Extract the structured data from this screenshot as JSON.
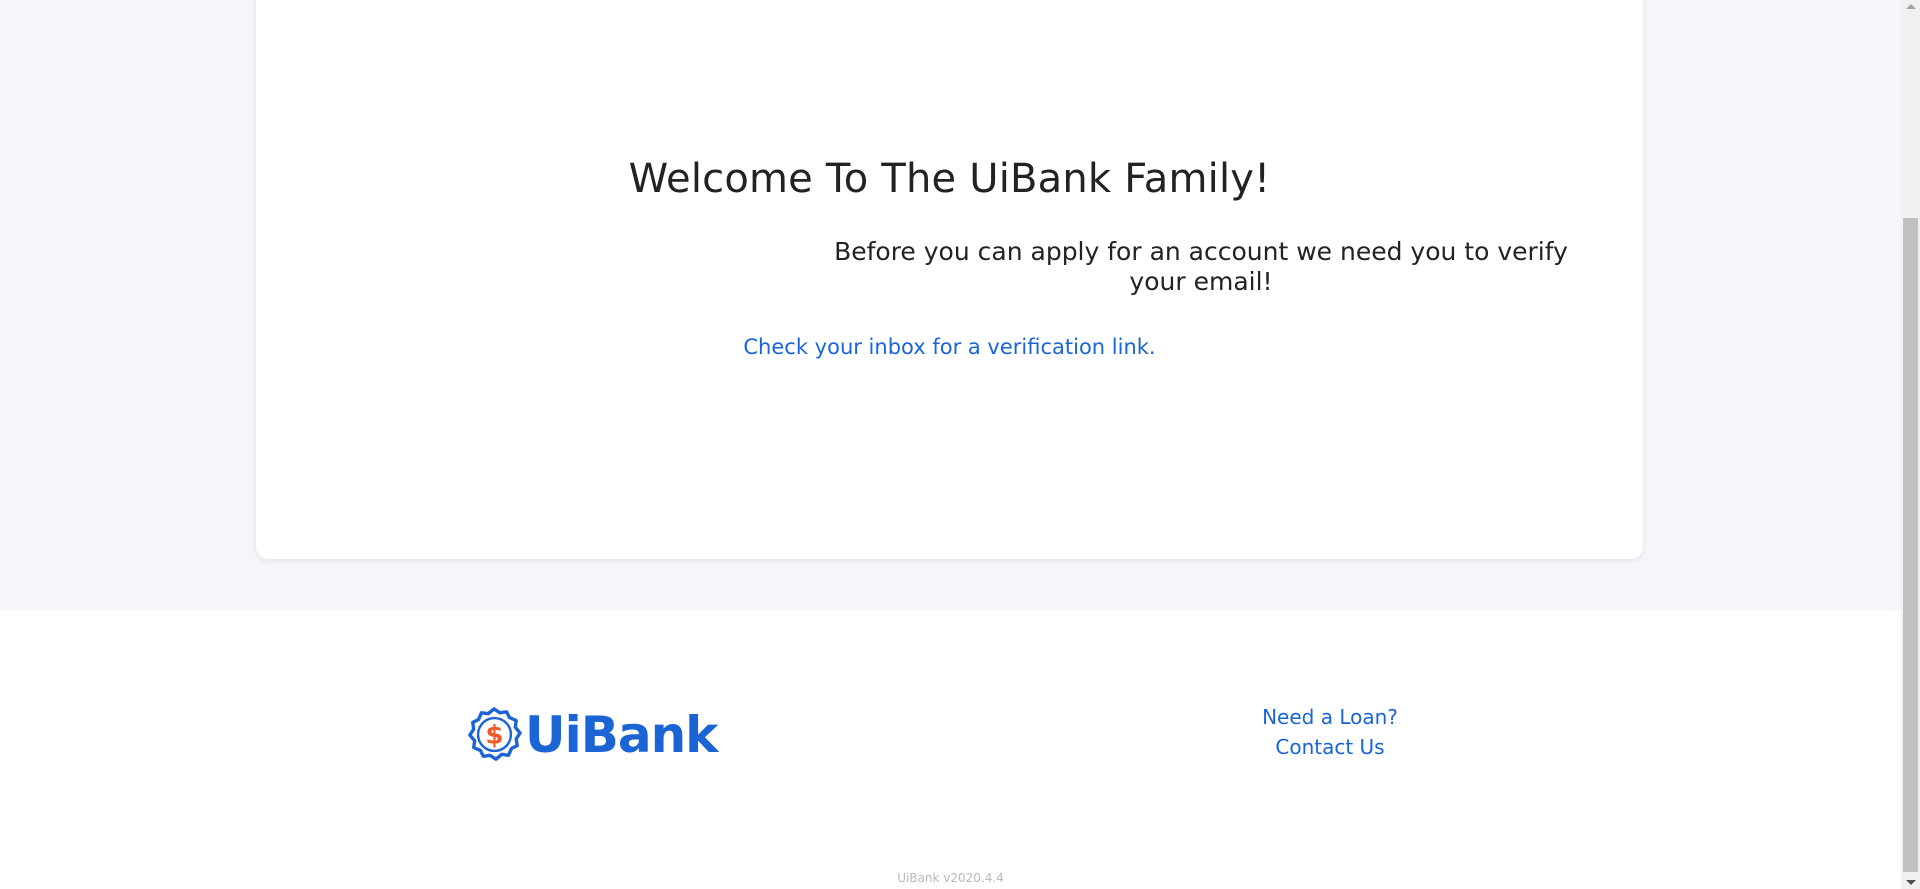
{
  "main": {
    "title": "Welcome To The UiBank Family!",
    "message": "Before you can apply for an account we need you to verify your email!",
    "instruction": "Check your inbox for a verification link."
  },
  "footer": {
    "logo_symbol": "$",
    "logo_text": "UiBank",
    "links": [
      {
        "label": "Need a Loan?"
      },
      {
        "label": "Contact Us"
      }
    ],
    "version": "UiBank v2020.4.4"
  },
  "colors": {
    "brand_blue": "#1a64d6",
    "accent_orange": "#f05a28",
    "page_background": "#f5f6f9"
  },
  "icons": {
    "logo_badge": "dollar-badge-icon",
    "scroll_up": "scroll-up-arrow-icon",
    "scroll_down": "scroll-down-arrow-icon"
  }
}
